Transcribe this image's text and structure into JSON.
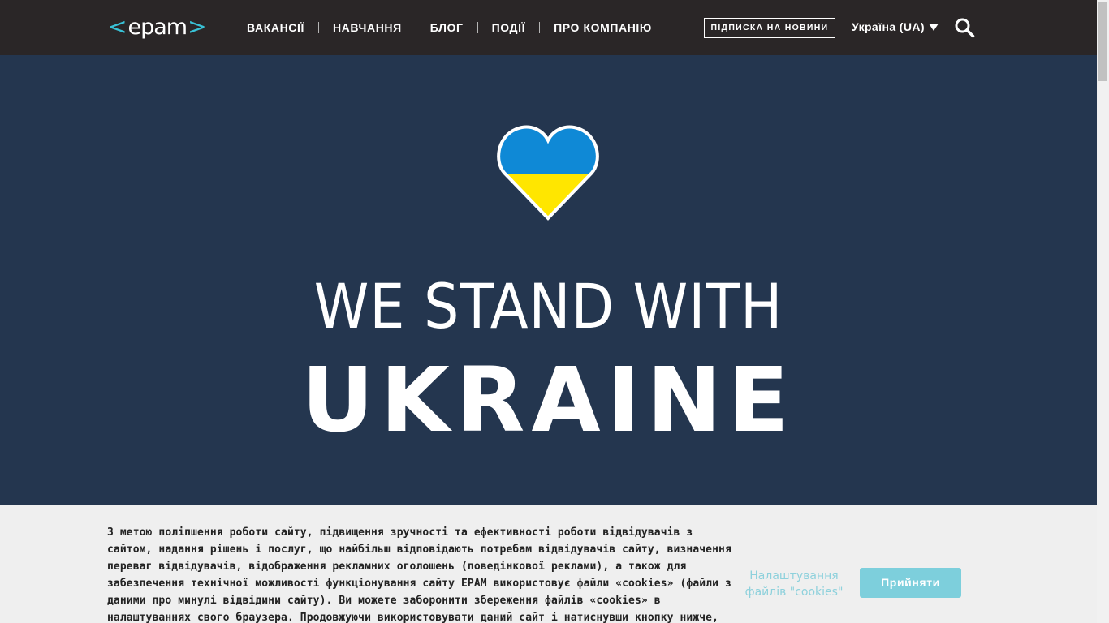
{
  "header": {
    "logo_text": "epam",
    "logo_left": "<",
    "logo_right": ">",
    "nav": [
      {
        "label": "ВАКАНСІЇ"
      },
      {
        "label": "НАВЧАННЯ"
      },
      {
        "label": "БЛОГ"
      },
      {
        "label": "ПОДІЇ"
      },
      {
        "label": "ПРО КОМПАНІЮ"
      }
    ],
    "subscribe_label": "ПІДПИСКА НА НОВИНИ",
    "country_label": "Україна (UA)",
    "icons": [
      "chevron-down-icon",
      "search-icon"
    ]
  },
  "hero": {
    "line1": "WE STAND WITH",
    "line2": "UKRAINE",
    "icon": "heart-icon",
    "colors": {
      "background": "#24364f",
      "heart_top": "#0f89d6",
      "heart_bottom": "#ffe600"
    }
  },
  "cookie_banner": {
    "text": "З метою поліпшення роботи сайту, підвищення зручності та ефективності роботи відвідувачів з сайтом, надання рішень і послуг, що найбільш відповідають потребам відвідувачів сайту, визначення переваг відвідувачів, відображення рекламних оголошень (поведінкової реклами), а також для забезпечення технічної можливості функціонування сайту EPAM використовує файли «cookies» (файли з даними про минулі відвідини сайту). Ви можете заборонити збереження файлів «cookies» в налаштуваннях свого браузера. Продовжуючи використовувати даний сайт і натиснувши кнопку нижче, ви підтверджуєте",
    "settings_label": "Налаштування файлів \"cookies\"",
    "accept_label": "Прийняти",
    "colors": {
      "accept": "#7dcfdc"
    }
  }
}
